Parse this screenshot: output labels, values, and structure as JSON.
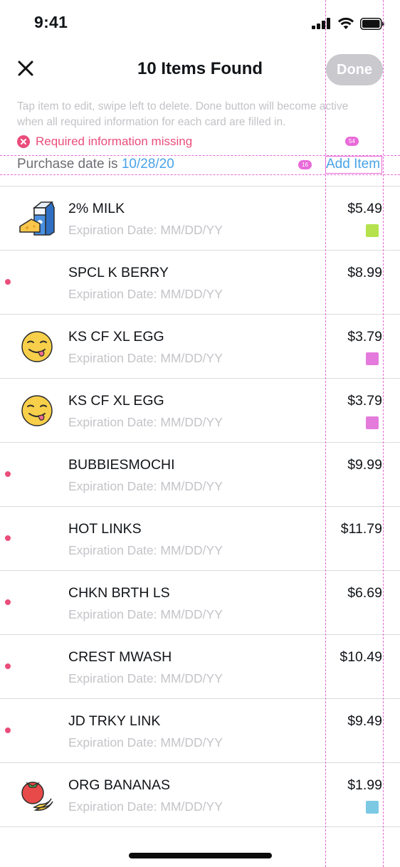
{
  "status_bar": {
    "time": "9:41"
  },
  "header": {
    "title": "10 Items Found",
    "done_label": "Done"
  },
  "instructions": "Tap item to edit, swipe left to delete. Done button will become active when all required information for each card are filled in.",
  "required_missing": "Required information missing",
  "purchase": {
    "label": "Purchase date is",
    "date": "10/28/20"
  },
  "add_item_label": "Add Item",
  "overlay_labels": {
    "width": "54",
    "height": "16"
  },
  "colors": {
    "accent_blue": "#4aa3e8",
    "alert_pink": "#ea4d7b",
    "done_disabled": "#c9c9ce"
  },
  "items": [
    {
      "name": "2% MILK",
      "expiration": "Expiration Date: MM/DD/YY",
      "price": "$5.49",
      "icon": "milk-cheese-icon",
      "swatch": "#b5e24c",
      "missing": false
    },
    {
      "name": "SPCL K BERRY",
      "expiration": "Expiration Date: MM/DD/YY",
      "price": "$8.99",
      "icon": "",
      "swatch": "",
      "missing": true
    },
    {
      "name": "KS CF XL EGG",
      "expiration": "Expiration Date: MM/DD/YY",
      "price": "$3.79",
      "icon": "yum-face-icon",
      "swatch": "#e47bdc",
      "missing": false
    },
    {
      "name": "KS CF XL EGG",
      "expiration": "Expiration Date: MM/DD/YY",
      "price": "$3.79",
      "icon": "yum-face-icon",
      "swatch": "#e47bdc",
      "missing": false
    },
    {
      "name": "BUBBIESMOCHI",
      "expiration": "Expiration Date: MM/DD/YY",
      "price": "$9.99",
      "icon": "",
      "swatch": "",
      "missing": true
    },
    {
      "name": "HOT LINKS",
      "expiration": "Expiration Date: MM/DD/YY",
      "price": "$11.79",
      "icon": "",
      "swatch": "",
      "missing": true
    },
    {
      "name": "CHKN BRTH LS",
      "expiration": "Expiration Date: MM/DD/YY",
      "price": "$6.69",
      "icon": "",
      "swatch": "",
      "missing": true
    },
    {
      "name": "CREST MWASH",
      "expiration": "Expiration Date: MM/DD/YY",
      "price": "$10.49",
      "icon": "",
      "swatch": "",
      "missing": true
    },
    {
      "name": "JD TRKY LINK",
      "expiration": "Expiration Date: MM/DD/YY",
      "price": "$9.49",
      "icon": "",
      "swatch": "",
      "missing": true
    },
    {
      "name": "ORG BANANAS",
      "expiration": "Expiration Date: MM/DD/YY",
      "price": "$1.99",
      "icon": "tomato-banana-icon",
      "swatch": "#7cc9e4",
      "missing": false
    }
  ]
}
